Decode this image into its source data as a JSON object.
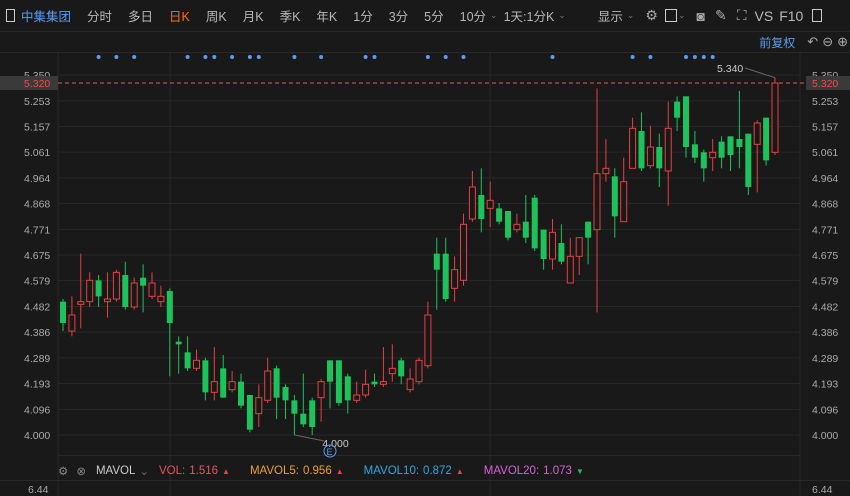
{
  "toolbar": {
    "stock_name": "中集集团",
    "tabs": [
      "分时",
      "多日",
      "日K",
      "周K",
      "月K",
      "季K",
      "年K",
      "1分",
      "3分",
      "5分",
      "10分"
    ],
    "active_tab": "日K",
    "range_select": "1天:1分K",
    "display_label": "显示",
    "vs_label": "VS",
    "f10_label": "F10"
  },
  "subbar": {
    "adjust_label": "前复权"
  },
  "colors": {
    "up": "#e8403f",
    "down": "#1ec25a",
    "bg": "#191919",
    "grid": "#282828",
    "last_price_line": "#e0604a"
  },
  "price_axis": {
    "labels": [
      "5.350",
      "5.253",
      "5.157",
      "5.061",
      "4.964",
      "4.868",
      "4.771",
      "4.675",
      "4.579",
      "4.482",
      "4.386",
      "4.289",
      "4.193",
      "4.096",
      "4.000"
    ],
    "last_price": "5.320"
  },
  "annotations": {
    "high": "5.340",
    "low": "4.000",
    "event_icon": "E"
  },
  "volume": {
    "indicator": "MAVOL",
    "vol_label": "VOL:",
    "vol": "1.516",
    "mavol5_label": "MAVOL5:",
    "mavol5": "0.956",
    "mavol10_label": "MAVOL10:",
    "mavol10": "0.872",
    "mavol20_label": "MAVOL20:",
    "mavol20": "1.073",
    "axis_left": "6.44",
    "axis_right": "6.44"
  },
  "chart_data": {
    "type": "candlestick",
    "ylim": [
      4.0,
      5.35
    ],
    "event_marker_indices": [
      4,
      6,
      8,
      14,
      16,
      17,
      19,
      21,
      22,
      26,
      29,
      34,
      35,
      41,
      43,
      45,
      55,
      64,
      66,
      70,
      71,
      72,
      73
    ],
    "ohlc": [
      [
        4.5,
        4.51,
        4.39,
        4.42
      ],
      [
        4.39,
        4.52,
        4.37,
        4.45
      ],
      [
        4.49,
        4.68,
        4.4,
        4.5
      ],
      [
        4.5,
        4.61,
        4.48,
        4.58
      ],
      [
        4.58,
        4.6,
        4.48,
        4.52
      ],
      [
        4.5,
        4.61,
        4.44,
        4.51
      ],
      [
        4.51,
        4.62,
        4.5,
        4.61
      ],
      [
        4.6,
        4.65,
        4.47,
        4.48
      ],
      [
        4.48,
        4.59,
        4.47,
        4.57
      ],
      [
        4.59,
        4.64,
        4.46,
        4.56
      ],
      [
        4.52,
        4.61,
        4.51,
        4.57
      ],
      [
        4.5,
        4.56,
        4.48,
        4.52
      ],
      [
        4.54,
        4.55,
        4.22,
        4.42
      ],
      [
        4.35,
        4.37,
        4.23,
        4.34
      ],
      [
        4.31,
        4.37,
        4.24,
        4.25
      ],
      [
        4.25,
        4.32,
        4.24,
        4.28
      ],
      [
        4.28,
        4.29,
        4.13,
        4.16
      ],
      [
        4.16,
        4.33,
        4.13,
        4.2
      ],
      [
        4.25,
        4.3,
        4.14,
        4.14
      ],
      [
        4.17,
        4.24,
        4.16,
        4.2
      ],
      [
        4.2,
        4.23,
        4.1,
        4.11
      ],
      [
        4.15,
        4.15,
        4.01,
        4.02
      ],
      [
        4.08,
        4.19,
        4.03,
        4.14
      ],
      [
        4.13,
        4.29,
        4.12,
        4.24
      ],
      [
        4.25,
        4.26,
        4.06,
        4.14
      ],
      [
        4.18,
        4.19,
        4.06,
        4.13
      ],
      [
        4.13,
        4.15,
        4.0,
        4.08
      ],
      [
        4.08,
        4.23,
        4.03,
        4.04
      ],
      [
        4.13,
        4.14,
        4.0,
        4.03
      ],
      [
        4.14,
        4.21,
        4.05,
        4.2
      ],
      [
        4.28,
        4.28,
        4.1,
        4.2
      ],
      [
        4.28,
        4.28,
        4.11,
        4.12
      ],
      [
        4.22,
        4.23,
        4.08,
        4.13
      ],
      [
        4.13,
        4.2,
        4.12,
        4.15
      ],
      [
        4.15,
        4.245,
        4.14,
        4.19
      ],
      [
        4.2,
        4.23,
        4.18,
        4.19
      ],
      [
        4.19,
        4.33,
        4.18,
        4.2
      ],
      [
        4.23,
        4.34,
        4.2,
        4.25
      ],
      [
        4.28,
        4.29,
        4.19,
        4.22
      ],
      [
        4.17,
        4.25,
        4.16,
        4.21
      ],
      [
        4.2,
        4.29,
        4.19,
        4.28
      ],
      [
        4.26,
        4.5,
        4.25,
        4.45
      ],
      [
        4.68,
        4.74,
        4.47,
        4.62
      ],
      [
        4.68,
        4.74,
        4.5,
        4.51
      ],
      [
        4.55,
        4.67,
        4.5,
        4.62
      ],
      [
        4.58,
        4.83,
        4.56,
        4.79
      ],
      [
        4.81,
        4.99,
        4.8,
        4.93
      ],
      [
        4.9,
        5.0,
        4.76,
        4.81
      ],
      [
        4.85,
        4.95,
        4.78,
        4.88
      ],
      [
        4.85,
        4.87,
        4.79,
        4.8
      ],
      [
        4.84,
        4.84,
        4.73,
        4.74
      ],
      [
        4.77,
        4.83,
        4.76,
        4.79
      ],
      [
        4.8,
        4.9,
        4.72,
        4.74
      ],
      [
        4.89,
        4.9,
        4.69,
        4.7
      ],
      [
        4.77,
        4.77,
        4.62,
        4.66
      ],
      [
        4.66,
        4.81,
        4.62,
        4.76
      ],
      [
        4.72,
        4.79,
        4.64,
        4.65
      ],
      [
        4.57,
        4.74,
        4.57,
        4.67
      ],
      [
        4.67,
        4.74,
        4.6,
        4.74
      ],
      [
        4.8,
        4.8,
        4.64,
        4.74
      ],
      [
        4.77,
        5.3,
        4.46,
        4.98
      ],
      [
        4.98,
        5.11,
        4.95,
        5.0
      ],
      [
        4.97,
        5.0,
        4.74,
        4.82
      ],
      [
        4.8,
        5.04,
        4.8,
        4.95
      ],
      [
        5.0,
        5.19,
        5.0,
        5.15
      ],
      [
        5.14,
        5.21,
        4.99,
        5.0
      ],
      [
        5.01,
        5.16,
        5.0,
        5.08
      ],
      [
        5.08,
        5.13,
        4.93,
        5.0
      ],
      [
        4.99,
        5.25,
        4.86,
        5.15
      ],
      [
        5.25,
        5.27,
        5.14,
        5.19
      ],
      [
        5.27,
        5.27,
        5.04,
        5.08
      ],
      [
        5.09,
        5.14,
        5.02,
        5.04
      ],
      [
        5.06,
        5.07,
        4.95,
        5.0
      ],
      [
        5.04,
        5.11,
        4.99,
        5.06
      ],
      [
        5.1,
        5.12,
        5.0,
        5.04
      ],
      [
        5.12,
        5.12,
        4.99,
        5.05
      ],
      [
        5.11,
        5.29,
        5.0,
        5.08
      ],
      [
        5.13,
        5.13,
        4.9,
        4.93
      ],
      [
        5.09,
        5.18,
        4.91,
        5.17
      ],
      [
        5.19,
        5.19,
        5.01,
        5.03
      ],
      [
        5.06,
        5.34,
        5.05,
        5.32
      ]
    ]
  }
}
